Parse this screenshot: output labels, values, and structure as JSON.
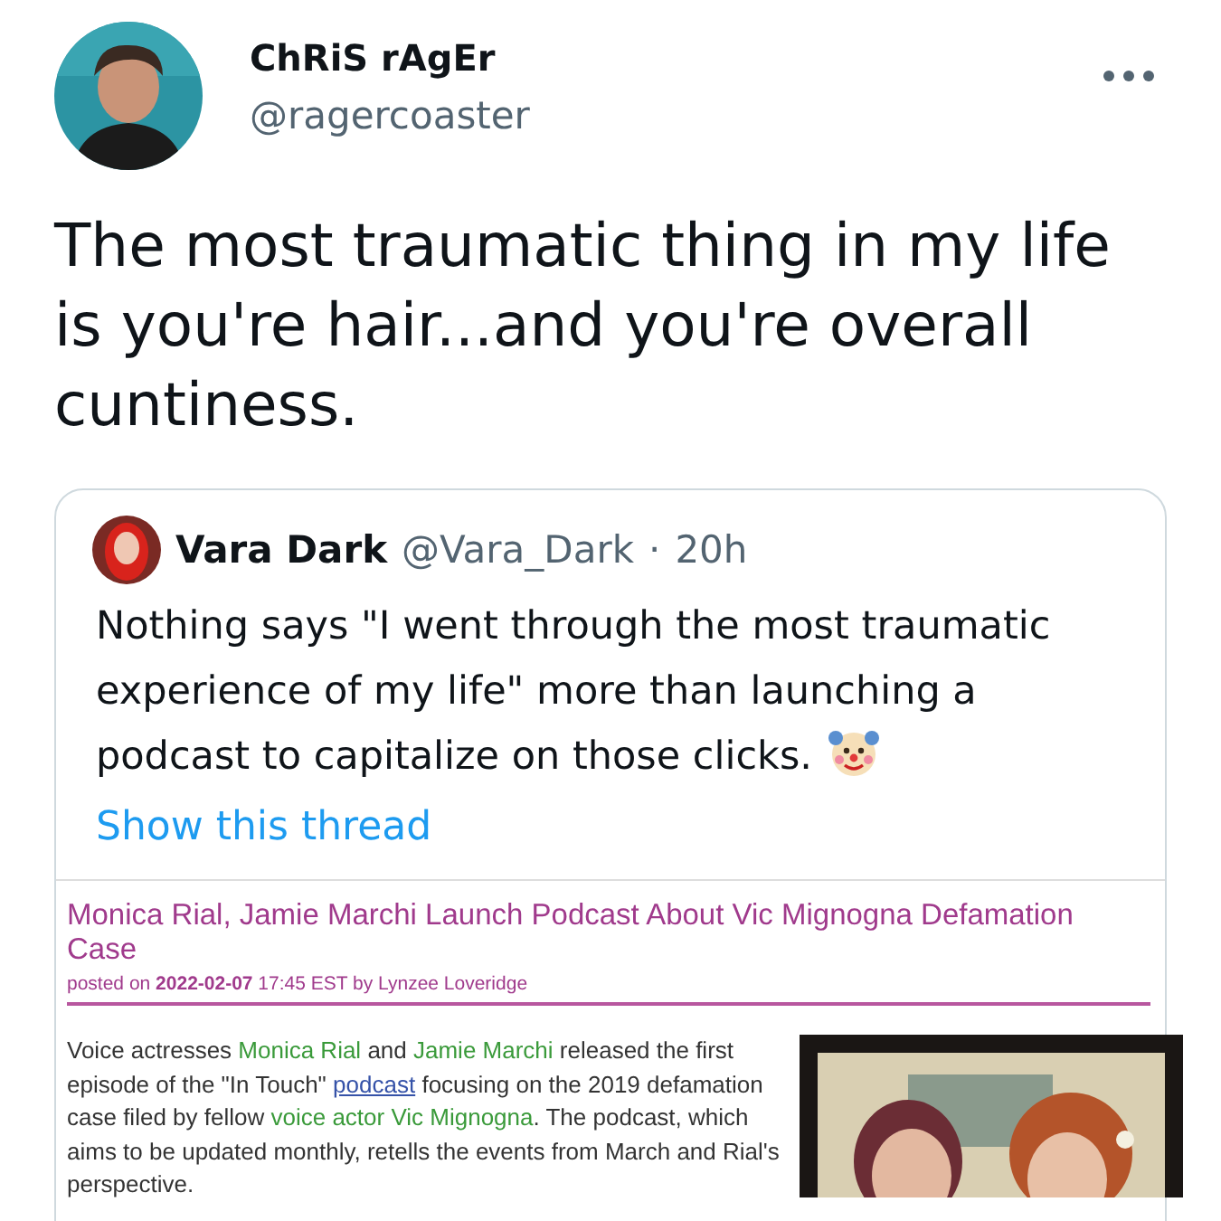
{
  "author": {
    "name": "ChRiS rAgEr",
    "handle": "@ragercoaster"
  },
  "tweet_text": "The most traumatic thing in my life is you're hair...and you're overall cuntiness.",
  "quoted_tweet": {
    "name": "Vara Dark",
    "handle": "@Vara_Dark",
    "separator": "·",
    "time": "20h",
    "text": "Nothing says \"I went through the most traumatic experience of my life\" more than launching a podcast to capitalize on those clicks.",
    "thread_link": "Show this thread",
    "article": {
      "title": "Monica Rial, Jamie Marchi Launch Podcast About Vic Mignogna Defamation Case",
      "byline": [
        {
          "text": "posted on ",
          "kind": "plain"
        },
        {
          "text": "2022-02-07",
          "kind": "bold"
        },
        {
          "text": " 17:45 EST by Lynzee Loveridge",
          "kind": "plain"
        }
      ],
      "body": [
        {
          "text": "Voice actresses ",
          "kind": "plain"
        },
        {
          "text": "Monica Rial",
          "kind": "tag"
        },
        {
          "text": " and ",
          "kind": "plain"
        },
        {
          "text": "Jamie Marchi",
          "kind": "tag"
        },
        {
          "text": " released the first episode of the \"In Touch\" ",
          "kind": "plain"
        },
        {
          "text": "podcast",
          "kind": "link"
        },
        {
          "text": " focusing on the 2019 defamation case filed by fellow ",
          "kind": "plain"
        },
        {
          "text": "voice actor Vic Mignogna",
          "kind": "tag"
        },
        {
          "text": ". The podcast, which aims to be updated monthly, retells the events from March and Rial's perspective.",
          "kind": "plain"
        }
      ]
    }
  }
}
